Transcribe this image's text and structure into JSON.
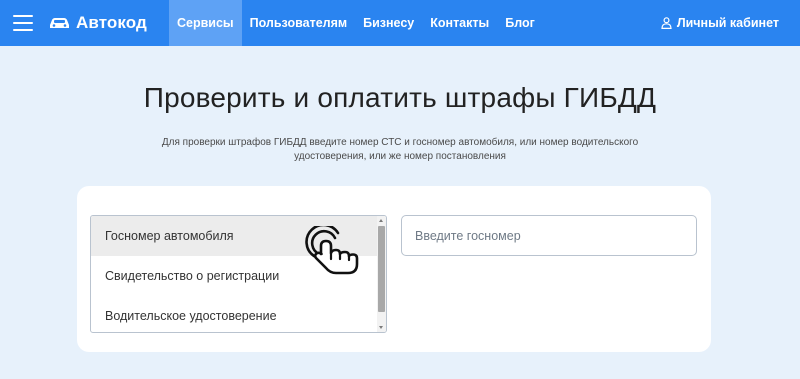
{
  "header": {
    "logo_text": "Автокод",
    "nav": [
      {
        "label": "Сервисы",
        "active": true
      },
      {
        "label": "Пользователям",
        "active": false
      },
      {
        "label": "Бизнесу",
        "active": false
      },
      {
        "label": "Контакты",
        "active": false
      },
      {
        "label": "Блог",
        "active": false
      }
    ],
    "account_label": "Личный кабинет",
    "icons": [
      "menu-icon",
      "car-logo-icon",
      "user-icon"
    ]
  },
  "hero": {
    "title": "Проверить и оплатить штрафы ГИБДД",
    "subtitle_line1": "Для проверки штрафов ГИБДД введите номер СТС и госномер автомобиля, или номер водительского",
    "subtitle_line2": "удостоверения, или же номер постановления"
  },
  "form": {
    "search_type": {
      "options": [
        "Госномер автомобиля",
        "Свидетельство о регистрации",
        "Водительское удостоверение"
      ],
      "selected": "Госномер автомобиля"
    },
    "plate": {
      "placeholder": "Введите госномер",
      "value": ""
    }
  },
  "colors": {
    "header_bg": "#2a84f0",
    "active_nav_bg": "#5ea2f5",
    "page_bg": "#e7f1fb",
    "card_bg": "#ffffff"
  }
}
